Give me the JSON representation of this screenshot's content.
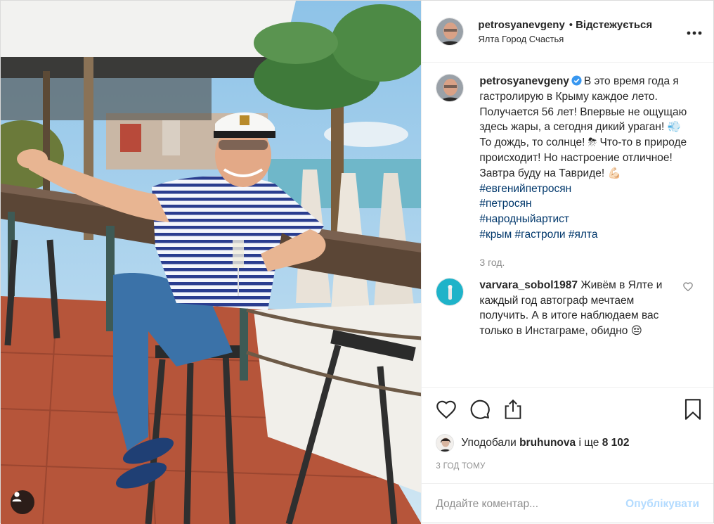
{
  "header": {
    "username": "petrosyanevgeny",
    "dot": "•",
    "follow_status": "Відстежується",
    "location": "Ялта Город Счастья",
    "more_icon": "more-horizontal-icon"
  },
  "caption": {
    "username": "petrosyanevgeny",
    "text": "В это время года я гастролирую в Крыму каждое лето. Получается 56 лет! Впервые не ощущаю здесь жары, а сегодня дикий ураган! 💨 То дождь, то солнце! ⛈ Что-то в природе происходит! Но настроение отличное!",
    "line2": "Завтра буду на Тавриде! 💪🏻",
    "hashtags": [
      "#евгенийпетросян",
      "#петросян",
      "#народныйартист"
    ],
    "hashtags_last": [
      "#крым",
      "#гастроли",
      "#ялта"
    ],
    "ago": "3 год."
  },
  "comment": {
    "username": "varvara_sobol1987",
    "text": "Живём в Ялте и каждый год автограф мечтаем получить. А в итоге наблюдаем вас только в Инстаграме, обидно 😔"
  },
  "likes": {
    "prefix": "Уподобали",
    "user": "bruhunova",
    "middle": "і ще",
    "count": "8 102"
  },
  "timestamp": "3 ГОД ТОМУ",
  "add_comment": {
    "placeholder": "Додайте коментар...",
    "publish": "Опублікувати"
  },
  "colors": {
    "link": "#00376b",
    "muted": "#8e8e8e",
    "publish_disabled": "#b3dbff",
    "verified": "#3897f0"
  }
}
